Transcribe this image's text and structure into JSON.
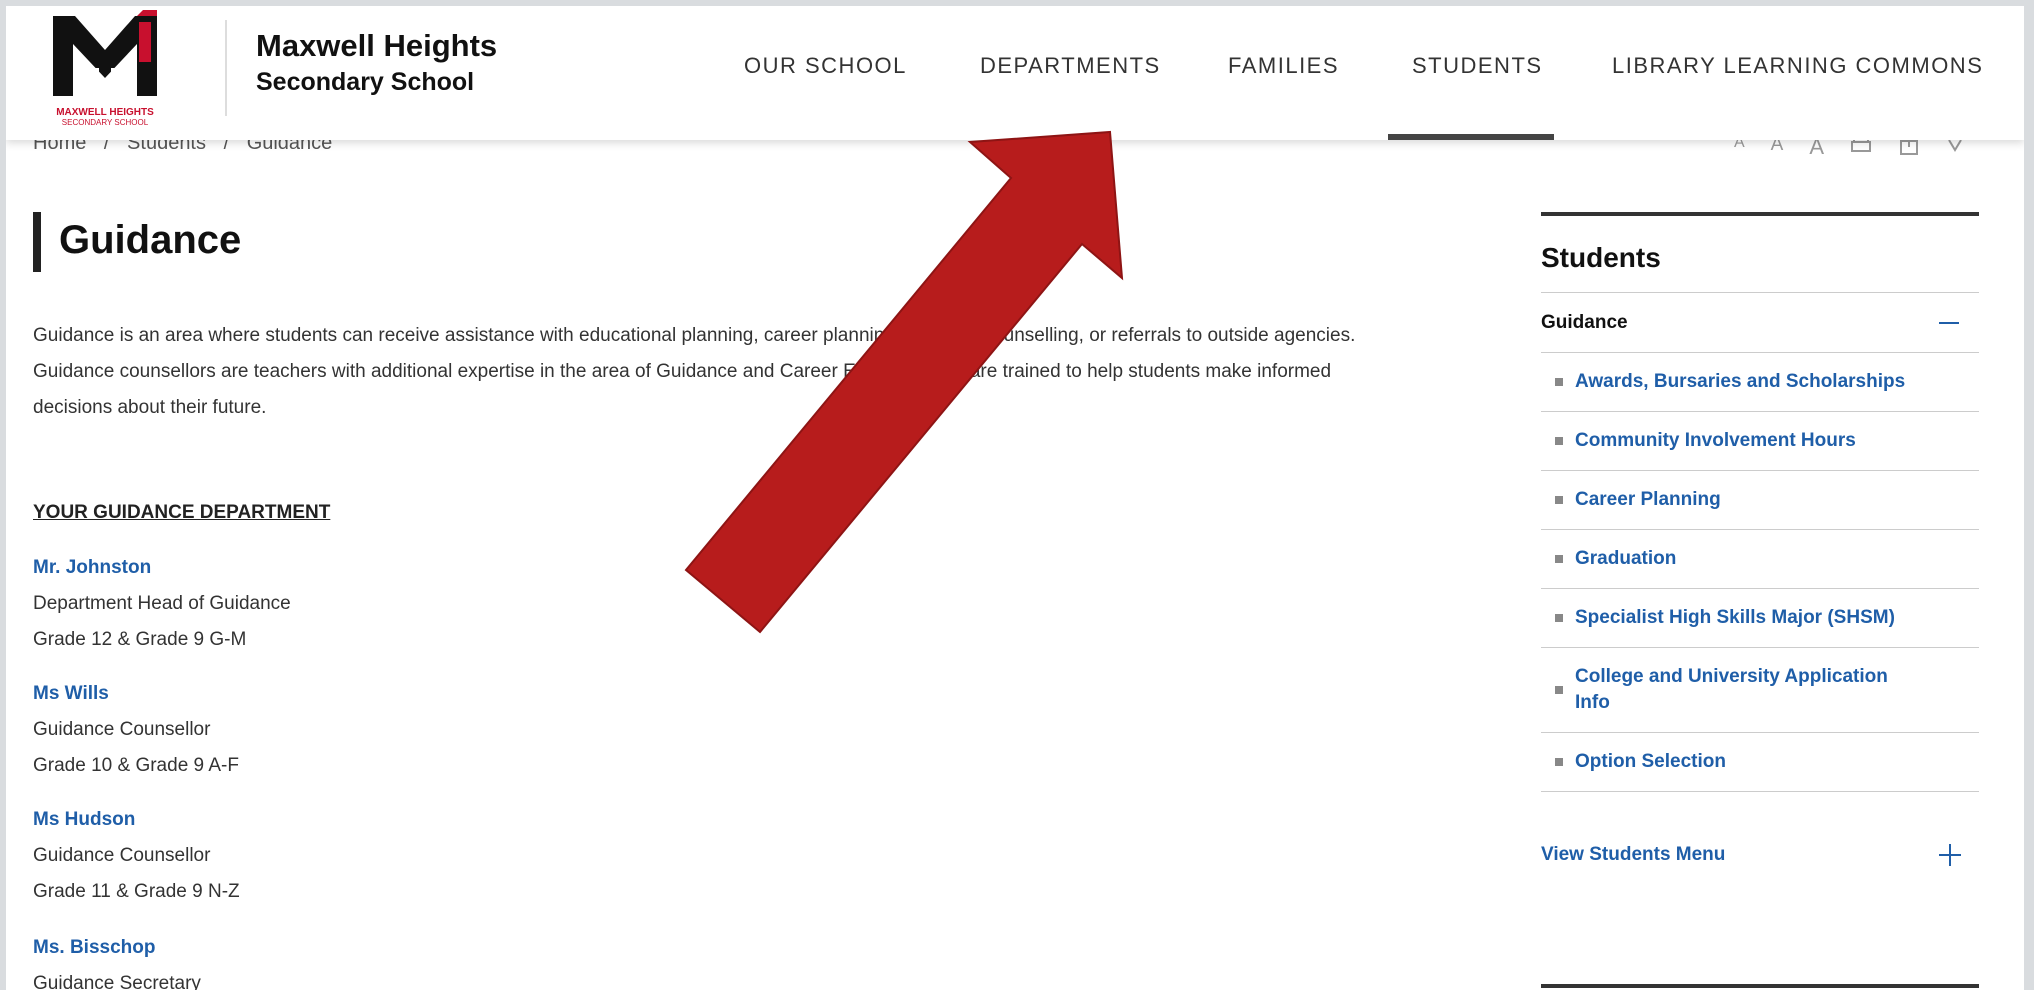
{
  "school": {
    "name_line1": "Maxwell Heights",
    "name_line2": "Secondary School",
    "logo_caption_line1": "MAXWELL HEIGHTS",
    "logo_caption_line2": "SECONDARY SCHOOL"
  },
  "nav": {
    "our_school": "OUR SCHOOL",
    "departments": "DEPARTMENTS",
    "families": "FAMILIES",
    "students": "STUDENTS",
    "library": "LIBRARY LEARNING COMMONS",
    "active": "STUDENTS"
  },
  "breadcrumb": [
    "Home",
    "/",
    "Students",
    "/",
    "Guidance"
  ],
  "page": {
    "title": "Guidance",
    "intro_line1": "Guidance is an area where students can receive assistance with educational planning, career planning, personal counselling, or referrals to outside agencies.",
    "intro_line2": "Guidance counsellors are teachers with additional expertise in the area of Guidance and Career Education and are trained to help students make informed",
    "intro_line3": "decisions about their future.",
    "department_heading": "YOUR GUIDANCE DEPARTMENT",
    "staff": [
      {
        "name": "Mr. Johnston",
        "role": "Department Head of Guidance",
        "grades": "Grade 12 & Grade 9 G-M"
      },
      {
        "name": "Ms Wills",
        "role": "Guidance Counsellor",
        "grades": "Grade 10 & Grade 9 A-F"
      },
      {
        "name": "Ms Hudson",
        "role": "Guidance Counsellor",
        "grades": "Grade 11 & Grade 9 N-Z"
      },
      {
        "name": "Ms. Bisschop",
        "role": "Guidance Secretary",
        "grades": ""
      }
    ]
  },
  "sidebar": {
    "title": "Students",
    "current": "Guidance",
    "items": [
      "Awards, Bursaries and Scholarships",
      "Community Involvement Hours",
      "Career Planning",
      "Graduation",
      "Specialist High Skills Major (SHSM)",
      "College and University Application Info",
      "Option Selection"
    ],
    "view_menu": "View Students Menu"
  },
  "colors": {
    "brand_red": "#c8102e",
    "link_blue": "#1f5ea8",
    "arrow_red": "#b71c1c"
  }
}
